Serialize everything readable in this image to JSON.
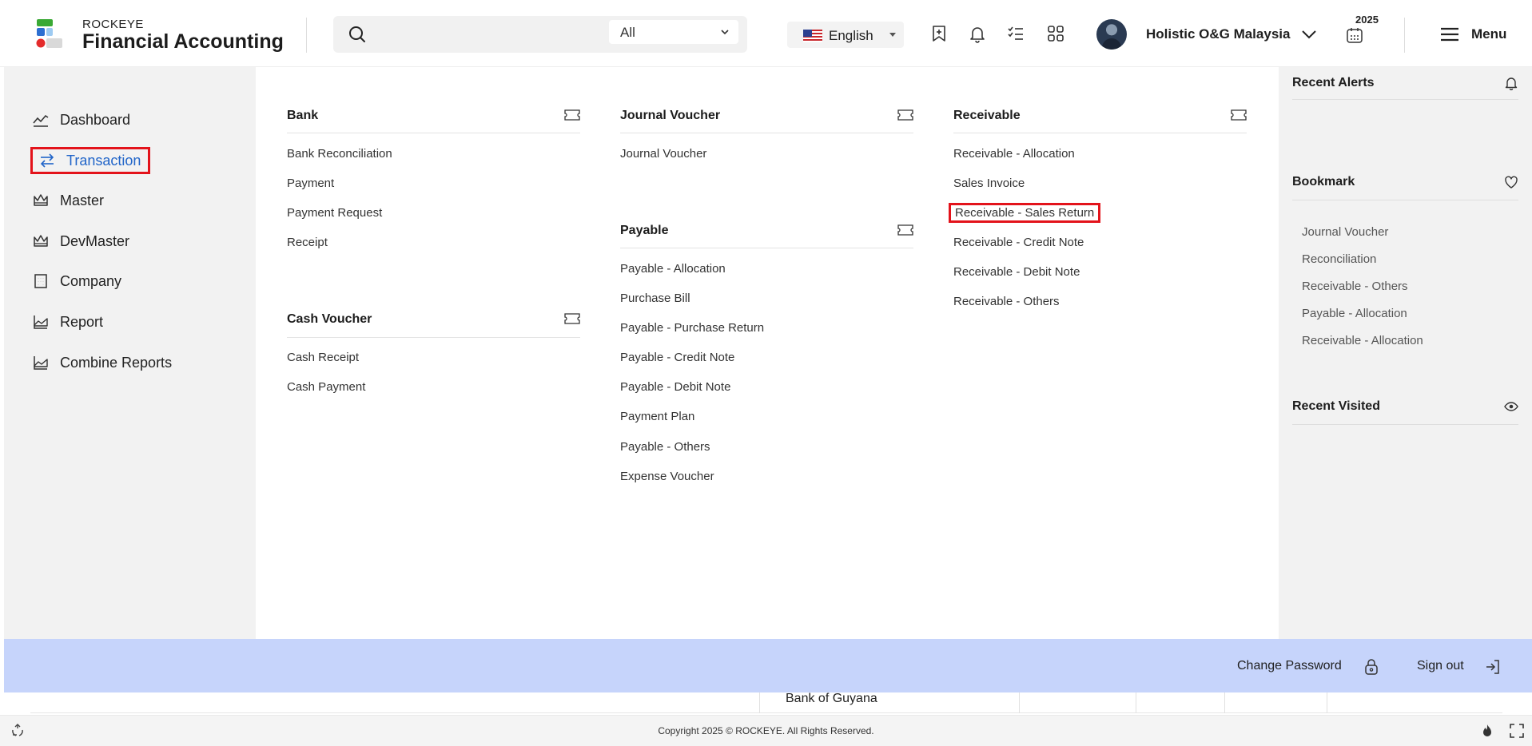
{
  "header": {
    "brand_small": "ROCKEYE",
    "brand_big": "Financial Accounting",
    "search": {
      "placeholder": "",
      "scope": "All"
    },
    "language": "English",
    "company": "Holistic O&G Malaysia",
    "year": "2025",
    "menu_label": "Menu"
  },
  "nav": {
    "items": [
      {
        "label": "Dashboard",
        "icon": "chart-line-icon"
      },
      {
        "label": "Transaction",
        "icon": "transfer-arrows-icon",
        "active": true
      },
      {
        "label": "Master",
        "icon": "crown-icon"
      },
      {
        "label": "DevMaster",
        "icon": "crown-icon"
      },
      {
        "label": "Company",
        "icon": "building-icon"
      },
      {
        "label": "Report",
        "icon": "area-chart-icon"
      },
      {
        "label": "Combine Reports",
        "icon": "area-chart-icon"
      }
    ]
  },
  "menu": {
    "bank": {
      "title": "Bank",
      "links": [
        "Bank Reconciliation",
        "Payment",
        "Payment Request",
        "Receipt"
      ]
    },
    "cash_voucher": {
      "title": "Cash Voucher",
      "links": [
        "Cash Receipt",
        "Cash Payment"
      ]
    },
    "journal_voucher": {
      "title": "Journal Voucher",
      "links": [
        "Journal Voucher"
      ]
    },
    "payable": {
      "title": "Payable",
      "links": [
        "Payable - Allocation",
        "Purchase Bill",
        "Payable - Purchase Return",
        "Payable - Credit Note",
        "Payable - Debit Note",
        "Payment Plan",
        "Payable - Others",
        "Expense Voucher"
      ]
    },
    "receivable": {
      "title": "Receivable",
      "links": [
        "Receivable - Allocation",
        "Sales Invoice",
        "Receivable - Sales Return",
        "Receivable - Credit Note",
        "Receivable - Debit Note",
        "Receivable - Others"
      ]
    }
  },
  "right_panel": {
    "recent_alerts": "Recent Alerts",
    "bookmark": "Bookmark",
    "bookmarks": [
      "Journal Voucher",
      "Reconciliation",
      "Receivable - Others",
      "Payable - Allocation",
      "Receivable - Allocation"
    ],
    "recent_visited": "Recent Visited"
  },
  "bottom_bar": {
    "change_password": "Change Password",
    "sign_out": "Sign out"
  },
  "underlay": {
    "row_text": "Bank of Guyana"
  },
  "footer": {
    "copyright": "Copyright 2025 © ROCKEYE. All Rights Reserved."
  },
  "colors": {
    "accent_blue": "#2165c9",
    "highlight_red": "#e3131b",
    "bottom_bar": "#c6d4fb",
    "panel_gray": "#f2f2f2"
  }
}
